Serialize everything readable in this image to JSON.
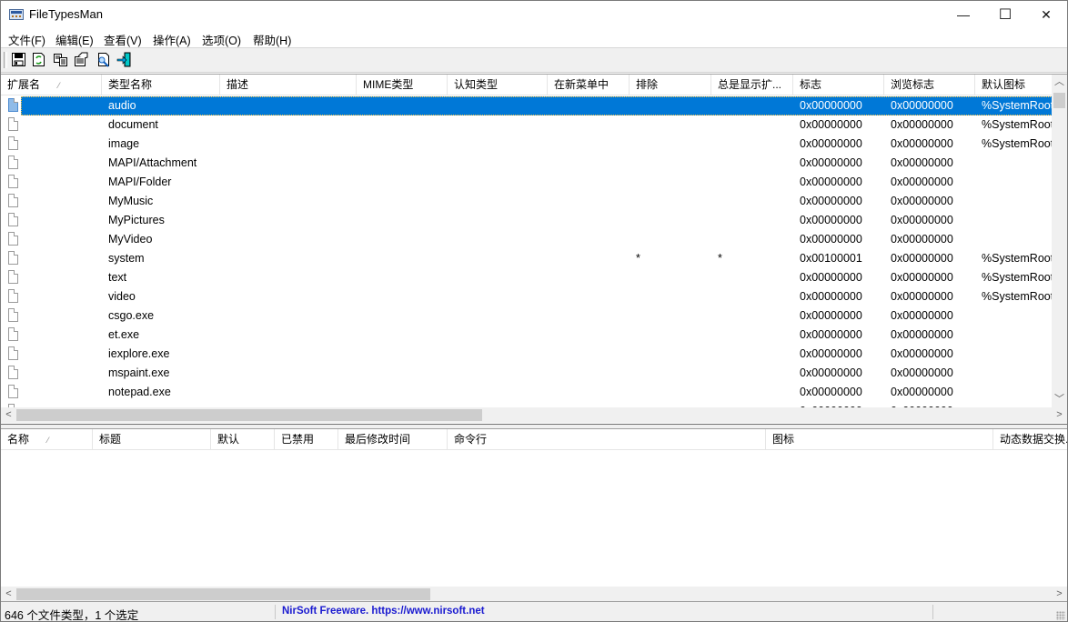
{
  "window": {
    "title": "FileTypesMan",
    "controls": {
      "minimize": "—",
      "maximize": "☐",
      "close": "✕"
    }
  },
  "menu": [
    {
      "label": "文件(F)"
    },
    {
      "label": "编辑(E)"
    },
    {
      "label": "查看(V)"
    },
    {
      "label": "操作(A)"
    },
    {
      "label": "选项(O)"
    },
    {
      "label": "帮助(H)"
    }
  ],
  "toolbar": [
    {
      "icon": "save-icon",
      "tooltip": "Save"
    },
    {
      "icon": "refresh-icon",
      "tooltip": "Refresh"
    },
    {
      "icon": "copy-icon",
      "tooltip": "Copy"
    },
    {
      "icon": "properties-icon",
      "tooltip": "Properties"
    },
    {
      "icon": "find-icon",
      "tooltip": "Find"
    },
    {
      "icon": "exit-icon",
      "tooltip": "Exit"
    }
  ],
  "upper_table": {
    "columns": [
      "扩展名",
      "类型名称",
      "描述",
      "MIME类型",
      "认知类型",
      "在新菜单中",
      "排除",
      "总是显示扩...",
      "标志",
      "浏览标志",
      "默认图标"
    ],
    "sort_indicator": "⁄",
    "selected_index": 0,
    "rows": [
      {
        "ext": "",
        "type": "audio",
        "desc": "",
        "mime": "",
        "perceived": "",
        "new_menu": "",
        "exclude": "",
        "always_show": "",
        "flags": "0x00000000",
        "browse_flags": "0x00000000",
        "default_icon": "%SystemRoot"
      },
      {
        "ext": "",
        "type": "document",
        "desc": "",
        "mime": "",
        "perceived": "",
        "new_menu": "",
        "exclude": "",
        "always_show": "",
        "flags": "0x00000000",
        "browse_flags": "0x00000000",
        "default_icon": "%SystemRoot"
      },
      {
        "ext": "",
        "type": "image",
        "desc": "",
        "mime": "",
        "perceived": "",
        "new_menu": "",
        "exclude": "",
        "always_show": "",
        "flags": "0x00000000",
        "browse_flags": "0x00000000",
        "default_icon": "%SystemRoot"
      },
      {
        "ext": "",
        "type": "MAPI/Attachment",
        "desc": "",
        "mime": "",
        "perceived": "",
        "new_menu": "",
        "exclude": "",
        "always_show": "",
        "flags": "0x00000000",
        "browse_flags": "0x00000000",
        "default_icon": ""
      },
      {
        "ext": "",
        "type": "MAPI/Folder",
        "desc": "",
        "mime": "",
        "perceived": "",
        "new_menu": "",
        "exclude": "",
        "always_show": "",
        "flags": "0x00000000",
        "browse_flags": "0x00000000",
        "default_icon": ""
      },
      {
        "ext": "",
        "type": "MyMusic",
        "desc": "",
        "mime": "",
        "perceived": "",
        "new_menu": "",
        "exclude": "",
        "always_show": "",
        "flags": "0x00000000",
        "browse_flags": "0x00000000",
        "default_icon": ""
      },
      {
        "ext": "",
        "type": "MyPictures",
        "desc": "",
        "mime": "",
        "perceived": "",
        "new_menu": "",
        "exclude": "",
        "always_show": "",
        "flags": "0x00000000",
        "browse_flags": "0x00000000",
        "default_icon": ""
      },
      {
        "ext": "",
        "type": "MyVideo",
        "desc": "",
        "mime": "",
        "perceived": "",
        "new_menu": "",
        "exclude": "",
        "always_show": "",
        "flags": "0x00000000",
        "browse_flags": "0x00000000",
        "default_icon": ""
      },
      {
        "ext": "",
        "type": "system",
        "desc": "",
        "mime": "",
        "perceived": "",
        "new_menu": "",
        "exclude": "*",
        "always_show": "*",
        "flags": "0x00100001",
        "browse_flags": "0x00000000",
        "default_icon": "%SystemRoot"
      },
      {
        "ext": "",
        "type": "text",
        "desc": "",
        "mime": "",
        "perceived": "",
        "new_menu": "",
        "exclude": "",
        "always_show": "",
        "flags": "0x00000000",
        "browse_flags": "0x00000000",
        "default_icon": "%SystemRoot"
      },
      {
        "ext": "",
        "type": "video",
        "desc": "",
        "mime": "",
        "perceived": "",
        "new_menu": "",
        "exclude": "",
        "always_show": "",
        "flags": "0x00000000",
        "browse_flags": "0x00000000",
        "default_icon": "%SystemRoot"
      },
      {
        "ext": "",
        "type": "csgo.exe",
        "desc": "",
        "mime": "",
        "perceived": "",
        "new_menu": "",
        "exclude": "",
        "always_show": "",
        "flags": "0x00000000",
        "browse_flags": "0x00000000",
        "default_icon": ""
      },
      {
        "ext": "",
        "type": "et.exe",
        "desc": "",
        "mime": "",
        "perceived": "",
        "new_menu": "",
        "exclude": "",
        "always_show": "",
        "flags": "0x00000000",
        "browse_flags": "0x00000000",
        "default_icon": ""
      },
      {
        "ext": "",
        "type": "iexplore.exe",
        "desc": "",
        "mime": "",
        "perceived": "",
        "new_menu": "",
        "exclude": "",
        "always_show": "",
        "flags": "0x00000000",
        "browse_flags": "0x00000000",
        "default_icon": ""
      },
      {
        "ext": "",
        "type": "mspaint.exe",
        "desc": "",
        "mime": "",
        "perceived": "",
        "new_menu": "",
        "exclude": "",
        "always_show": "",
        "flags": "0x00000000",
        "browse_flags": "0x00000000",
        "default_icon": ""
      },
      {
        "ext": "",
        "type": "notepad.exe",
        "desc": "",
        "mime": "",
        "perceived": "",
        "new_menu": "",
        "exclude": "",
        "always_show": "",
        "flags": "0x00000000",
        "browse_flags": "0x00000000",
        "default_icon": ""
      },
      {
        "ext": "",
        "type": "...",
        "desc": "",
        "mime": "",
        "perceived": "",
        "new_menu": "",
        "exclude": "",
        "always_show": "",
        "flags": "0x00000000",
        "browse_flags": "0x00000000",
        "default_icon": ""
      }
    ],
    "vscroll": {
      "position_fraction": 0.0,
      "visible_fraction": 0.03
    },
    "hscroll": {
      "position_fraction": 0.0,
      "visible_fraction": 0.45
    }
  },
  "lower_table": {
    "columns": [
      "名称",
      "标题",
      "默认",
      "已禁用",
      "最后修改时间",
      "命令行",
      "图标",
      "动态数据交换..."
    ],
    "sort_indicator": "⁄",
    "rows": [],
    "hscroll": {
      "position_fraction": 0.0,
      "visible_fraction": 0.4
    }
  },
  "statusbar": {
    "summary": "646 个文件类型，1 个选定",
    "link": "NirSoft Freeware. https://www.nirsoft.net"
  },
  "colors": {
    "selection": "#0078d7",
    "link": "#1a1ad0"
  }
}
